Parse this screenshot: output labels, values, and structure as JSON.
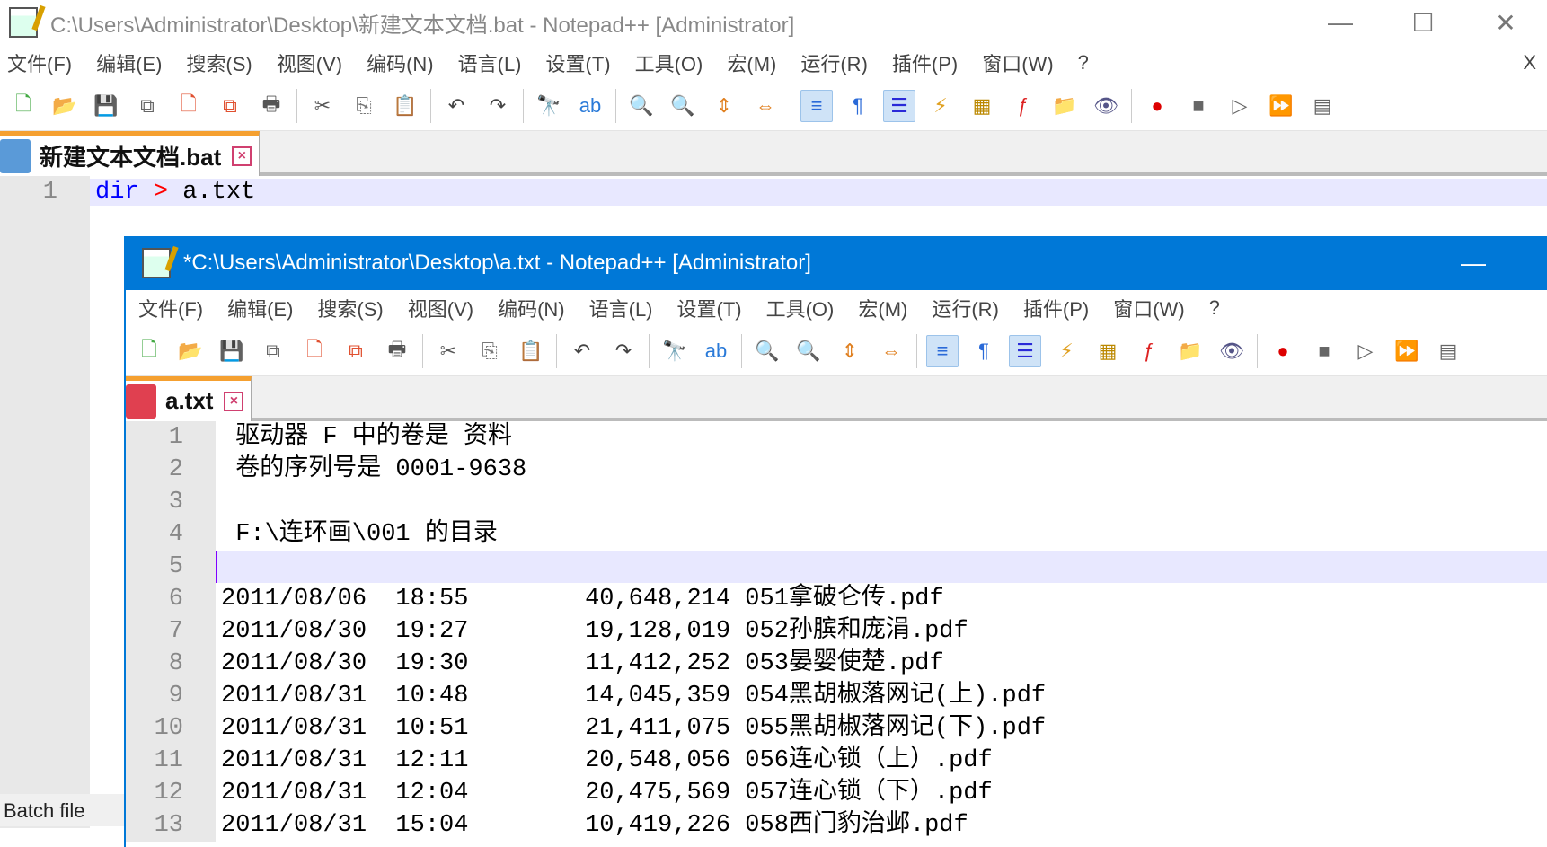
{
  "back": {
    "title": "C:\\Users\\Administrator\\Desktop\\新建文本文档.bat - Notepad++ [Administrator]",
    "menu": [
      "文件(F)",
      "编辑(E)",
      "搜索(S)",
      "视图(V)",
      "编码(N)",
      "语言(L)",
      "设置(T)",
      "工具(O)",
      "宏(M)",
      "运行(R)",
      "插件(P)",
      "窗口(W)",
      "?"
    ],
    "menu_close": "X",
    "tab": "新建文本文档.bat",
    "lines": [
      {
        "n": "1",
        "kw": "dir",
        "op": ">",
        "rest": "a.txt"
      }
    ],
    "status": "Batch file"
  },
  "front": {
    "title": "*C:\\Users\\Administrator\\Desktop\\a.txt - Notepad++ [Administrator]",
    "menu": [
      "文件(F)",
      "编辑(E)",
      "搜索(S)",
      "视图(V)",
      "编码(N)",
      "语言(L)",
      "设置(T)",
      "工具(O)",
      "宏(M)",
      "运行(R)",
      "插件(P)",
      "窗口(W)",
      "?"
    ],
    "tab": "a.txt",
    "lines": [
      {
        "n": "1",
        "t": " 驱动器 F 中的卷是 资料"
      },
      {
        "n": "2",
        "t": " 卷的序列号是 0001-9638"
      },
      {
        "n": "3",
        "t": ""
      },
      {
        "n": "4",
        "t": " F:\\连环画\\001 的目录"
      },
      {
        "n": "5",
        "t": ""
      },
      {
        "n": "6",
        "t": "2011/08/06  18:55        40,648,214 051拿破仑传.pdf"
      },
      {
        "n": "7",
        "t": "2011/08/30  19:27        19,128,019 052孙膑和庞涓.pdf"
      },
      {
        "n": "8",
        "t": "2011/08/30  19:30        11,412,252 053晏婴使楚.pdf"
      },
      {
        "n": "9",
        "t": "2011/08/31  10:48        14,045,359 054黑胡椒落网记(上).pdf"
      },
      {
        "n": "10",
        "t": "2011/08/31  10:51        21,411,075 055黑胡椒落网记(下).pdf"
      },
      {
        "n": "11",
        "t": "2011/08/31  12:11        20,548,056 056连心锁（上）.pdf"
      },
      {
        "n": "12",
        "t": "2011/08/31  12:04        20,475,569 057连心锁（下）.pdf"
      },
      {
        "n": "13",
        "t": "2011/08/31  15:04        10,419,226 058西门豹治邺.pdf"
      }
    ]
  },
  "window_buttons": {
    "min": "—",
    "max": "☐",
    "close": "✕"
  },
  "toolbar": [
    "new",
    "open",
    "save",
    "save-all",
    "close",
    "close-all",
    "print",
    "cut",
    "copy",
    "paste",
    "undo",
    "redo",
    "find",
    "replace",
    "zoom-in",
    "zoom-out",
    "sync-v",
    "sync-h",
    "word-wrap",
    "show-all",
    "indent-guide",
    "udl",
    "doc-map",
    "function-list",
    "folder",
    "monitor",
    "record",
    "stop",
    "play",
    "run-multiple",
    "save-macro"
  ],
  "toolbar_glyphs": [
    "🗋",
    "📂",
    "💾",
    "⧉",
    "🗋",
    "⧉",
    "🖶",
    "✂",
    "⎘",
    "📋",
    "↶",
    "↷",
    "🔭",
    "ab",
    "🔍",
    "🔍",
    "⇕",
    "⇔",
    "≡",
    "¶",
    "☰",
    "⚡",
    "▦",
    "ƒ",
    "📁",
    "👁",
    "●",
    "■",
    "▷",
    "⏩",
    "▤"
  ]
}
